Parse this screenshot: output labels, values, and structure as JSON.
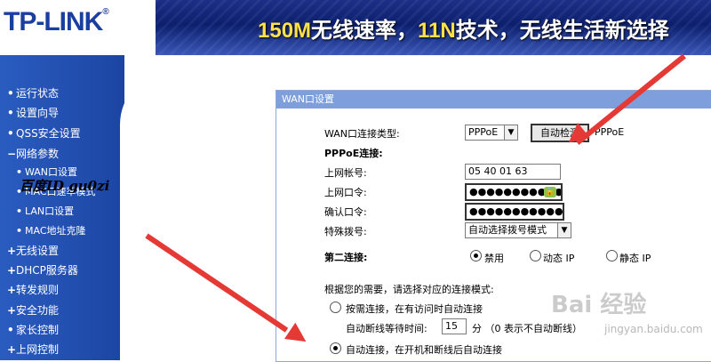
{
  "header": {
    "logo": "TP-LINK",
    "logo_reg": "®",
    "banner_speed": "150M",
    "banner_a": "无线速率，",
    "banner_tech": "11N",
    "banner_b": "技术，无线生活新选择"
  },
  "sidebar": {
    "items": [
      {
        "bullet": "•",
        "label": "运行状态"
      },
      {
        "bullet": "•",
        "label": "设置向导"
      },
      {
        "bullet": "•",
        "label": "QSS安全设置"
      },
      {
        "bullet": "−",
        "label": "网络参数"
      },
      {
        "bullet": "•",
        "label": "WAN口设置"
      },
      {
        "bullet": "•",
        "label": "MAC口速率模式"
      },
      {
        "bullet": "•",
        "label": "LAN口设置"
      },
      {
        "bullet": "•",
        "label": "MAC地址克隆"
      },
      {
        "bullet": "+",
        "label": "无线设置"
      },
      {
        "bullet": "+",
        "label": "DHCP服务器"
      },
      {
        "bullet": "+",
        "label": "转发规则"
      },
      {
        "bullet": "+",
        "label": "安全功能"
      },
      {
        "bullet": "•",
        "label": "家长控制"
      },
      {
        "bullet": "+",
        "label": "上网控制"
      }
    ]
  },
  "panel": {
    "title": "WAN口设置",
    "wan_type_label": "WAN口连接类型:",
    "wan_type_value": "PPPoE",
    "detect_button": "自动检测",
    "detect_result": "PPPoE",
    "pppoe_section": "PPPoE连接:",
    "account_label": "上网帐号:",
    "account_value": "05  40  01  63",
    "password_label": "上网口令:",
    "password_value": "●●●●●●●●●●●●",
    "confirm_label": "确认口令:",
    "confirm_value": "●●●●●●●●●●●●●",
    "dial_label": "特殊拨号:",
    "dial_value": "自动选择拨号模式",
    "second_label": "第二连接:",
    "second_options": [
      "禁用",
      "动态 IP",
      "静态 IP"
    ],
    "mode_hint": "根据您的需要，请选择对应的连接模式:",
    "mode_demand": "按需连接，在有访问时自动连接",
    "idle_label": "自动断线等待时间:",
    "idle_value": "15",
    "idle_unit": "分 （0 表示不自动断线）",
    "mode_auto": "自动连接，在开机和断线后自动连接"
  },
  "watermarks": {
    "baidu_id": "百度ID gu0zi",
    "baidu": "Bai 经验",
    "url": "jingyan.baidu.com"
  },
  "colors": {
    "sidebar": "#1e4aa9",
    "panel_title": "#7f9fdc",
    "arrow": "#e53935"
  }
}
